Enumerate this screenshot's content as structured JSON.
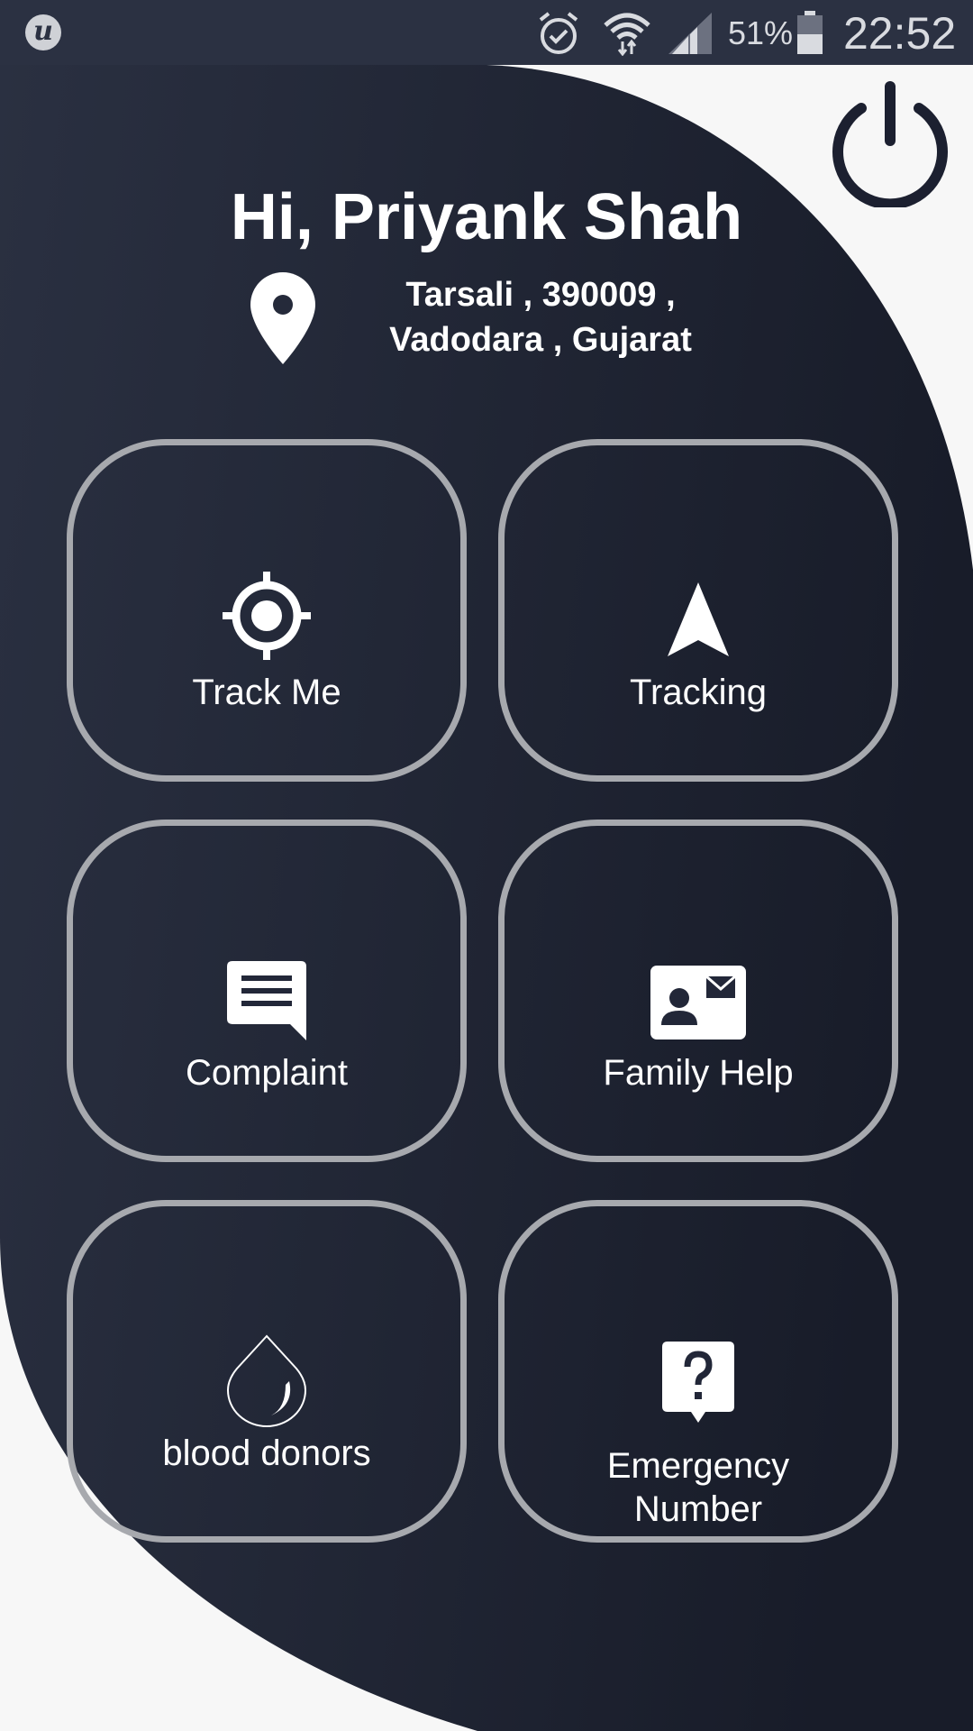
{
  "status_bar": {
    "app_icon": "u-logo-icon",
    "battery_percent": "51%",
    "time": "22:52",
    "icons": [
      "alarm-icon",
      "wifi-icon",
      "signal-icon",
      "battery-icon"
    ]
  },
  "header": {
    "greeting": "Hi, Priyank Shah",
    "address_line1": "Tarsali , 390009 ,",
    "address_line2": "Vadodara , Gujarat",
    "location_icon": "map-pin-icon",
    "power_icon": "power-icon"
  },
  "tiles": [
    {
      "label": "Track Me",
      "icon": "crosshair-icon"
    },
    {
      "label": "Tracking",
      "icon": "navigation-arrow-icon"
    },
    {
      "label": "Complaint",
      "icon": "message-icon"
    },
    {
      "label": "Family Help",
      "icon": "contact-card-icon"
    },
    {
      "label": "blood donors",
      "icon": "blood-drop-icon"
    },
    {
      "label_line1": "Emergency",
      "label_line2": "Number",
      "icon": "help-icon"
    }
  ],
  "colors": {
    "panel_dark": "#1c2030",
    "panel_light": "#2a3041",
    "status_bar": "#2b3142",
    "tile_border": "#a7a9ae",
    "background": "#f7f7f7"
  }
}
